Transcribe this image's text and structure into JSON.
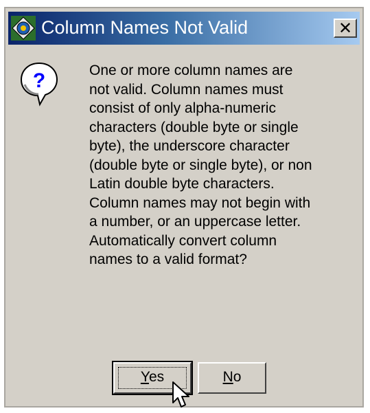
{
  "dialog": {
    "title": "Column Names Not Valid",
    "close_label": "✕",
    "message_lines": [
      "One or more column names are",
      "not valid.  Column names must",
      "consist of only alpha-numeric",
      "characters (double byte or single",
      "byte), the underscore character",
      "(double byte or single byte), or non",
      "Latin double byte characters.",
      "Column names may not begin with",
      "a number, or an uppercase letter.",
      "Automatically convert column",
      "names to a valid format?"
    ],
    "buttons": {
      "yes_mnemonic": "Y",
      "yes_rest": "es",
      "no_mnemonic": "N",
      "no_rest": "o"
    },
    "icons": {
      "title": "app-icon",
      "message": "question-icon",
      "pointer": "mouse-pointer-icon"
    }
  }
}
